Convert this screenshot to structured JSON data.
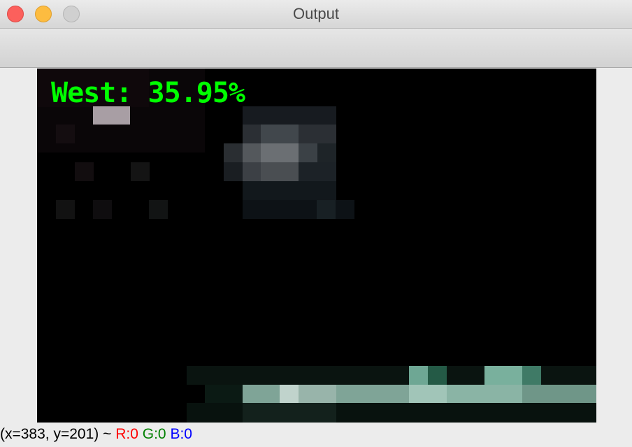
{
  "window": {
    "title": "Output"
  },
  "image": {
    "overlay_text": "West: 35.95%",
    "overlay_color": "#00ff00"
  },
  "status": {
    "coords": "(x=383, y=201) ~",
    "r": "R:0",
    "g": "G:0",
    "b": "B:0",
    "r_color": "#ff0000",
    "g_color": "#008000",
    "b_color": "#0000ff"
  },
  "colors": {
    "close": "#fc605c",
    "minimize": "#fdbc40",
    "zoom": "#d0d0d0",
    "window_bg": "#ececec"
  },
  "icons": [
    "close-icon",
    "minimize-icon",
    "zoom-icon"
  ]
}
